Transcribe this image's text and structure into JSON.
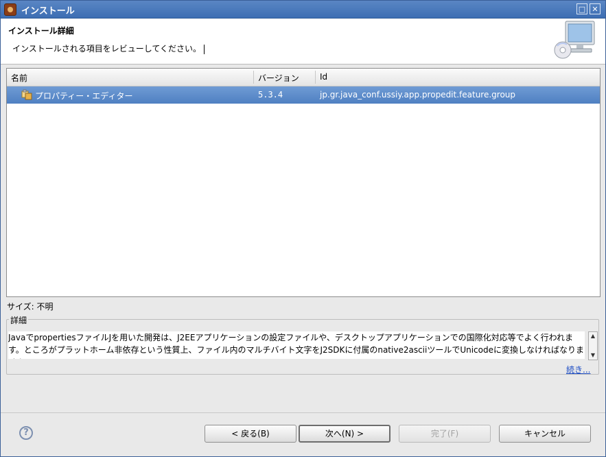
{
  "window": {
    "title": "インストール",
    "maximize_glyph": "□",
    "close_glyph": "✕"
  },
  "header": {
    "title": "インストール詳細",
    "description": "インストールされる項目をレビューしてください。"
  },
  "table": {
    "columns": [
      "名前",
      "バージョン",
      "Id"
    ],
    "rows": [
      {
        "name": "プロパティー・エディター",
        "version": "5.3.4",
        "id": "jp.gr.java_conf.ussiy.app.propedit.feature.group",
        "icon": "feature-plugin-icon",
        "selected": true
      }
    ]
  },
  "size": {
    "label": "サイズ: 不明"
  },
  "details": {
    "legend": "詳細",
    "text": "JavaでpropertiesファイルJを用いた開発は、J2EEアプリケーションの設定ファイルや、デスクトップアプリケーションでの国際化対応等でよく行われます。ところがプラットホーム非依存という性質上、ファイル内のマルチバイト文字をJ2SDKに付属のnative2asciiツールでUnicodeに変換しなければなりません",
    "more_link": "続き..."
  },
  "footer": {
    "help_glyph": "?",
    "back_button": "< 戻る(B)",
    "next_button": "次へ(N) >",
    "finish_button": "完了(F)",
    "cancel_button": "キャンセル"
  },
  "colors": {
    "selection": "#5a8acb",
    "titlebar": "#4a7abd",
    "link": "#1a4bc4"
  }
}
